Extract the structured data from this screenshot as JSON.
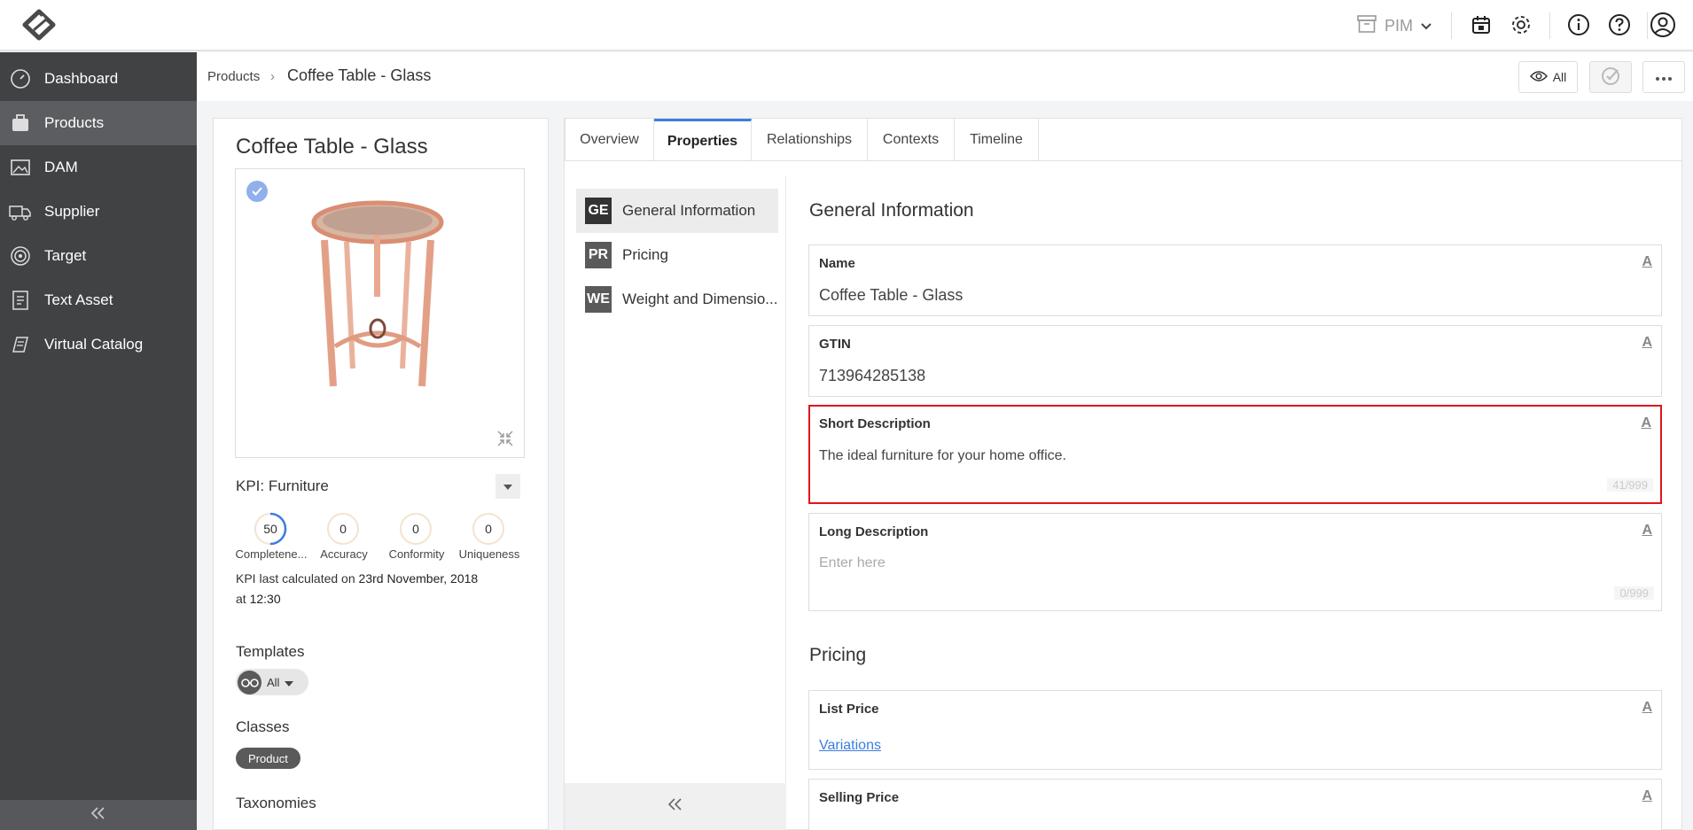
{
  "topbar": {
    "module_label": "PIM"
  },
  "sidebar": {
    "items": [
      {
        "label": "Dashboard",
        "icon": "dashboard-icon"
      },
      {
        "label": "Products",
        "icon": "products-icon"
      },
      {
        "label": "DAM",
        "icon": "image-icon"
      },
      {
        "label": "Supplier",
        "icon": "truck-icon"
      },
      {
        "label": "Target",
        "icon": "target-icon"
      },
      {
        "label": "Text Asset",
        "icon": "document-icon"
      },
      {
        "label": "Virtual Catalog",
        "icon": "catalog-icon"
      }
    ],
    "active_index": 1
  },
  "breadcrumb": {
    "root": "Products",
    "separator": "›",
    "current": "Coffee Table - Glass"
  },
  "header_actions": {
    "view_label": "All"
  },
  "product": {
    "title": "Coffee Table - Glass",
    "kpi": {
      "label": "KPI:",
      "profile": "Furniture",
      "metrics": [
        {
          "name": "Completene...",
          "value": "50",
          "progress": 0.5
        },
        {
          "name": "Accuracy",
          "value": "0",
          "progress": 0
        },
        {
          "name": "Conformity",
          "value": "0",
          "progress": 0
        },
        {
          "name": "Uniqueness",
          "value": "0",
          "progress": 0
        }
      ],
      "note_prefix": "KPI last calculated on",
      "note_date": "23rd November, 2018",
      "note_at": "at",
      "note_time": "12:30"
    },
    "templates_label": "Templates",
    "templates_value": "All",
    "classes_label": "Classes",
    "class_value": "Product",
    "taxonomies_label": "Taxonomies"
  },
  "tabs": [
    "Overview",
    "Properties",
    "Relationships",
    "Contexts",
    "Timeline"
  ],
  "active_tab": 1,
  "groups": [
    {
      "code": "GE",
      "label": "General Information"
    },
    {
      "code": "PR",
      "label": "Pricing"
    },
    {
      "code": "WE",
      "label": "Weight and Dimensio..."
    }
  ],
  "form": {
    "general_title": "General Information",
    "name_label": "Name",
    "name_value": "Coffee Table - Glass",
    "gtin_label": "GTIN",
    "gtin_value": "713964285138",
    "short_desc_label": "Short Description",
    "short_desc_value": "The ideal furniture for your home office.",
    "short_desc_counter": "41/999",
    "long_desc_label": "Long Description",
    "long_desc_placeholder": "Enter here",
    "long_desc_counter": "0/999",
    "pricing_title": "Pricing",
    "list_price_label": "List Price",
    "list_price_link": "Variations",
    "selling_price_label": "Selling Price",
    "attr_icon_label": "A"
  },
  "colors": {
    "sidebar_bg": "#414244",
    "accent": "#3b7ddd",
    "highlight_border": "#e0161b"
  }
}
